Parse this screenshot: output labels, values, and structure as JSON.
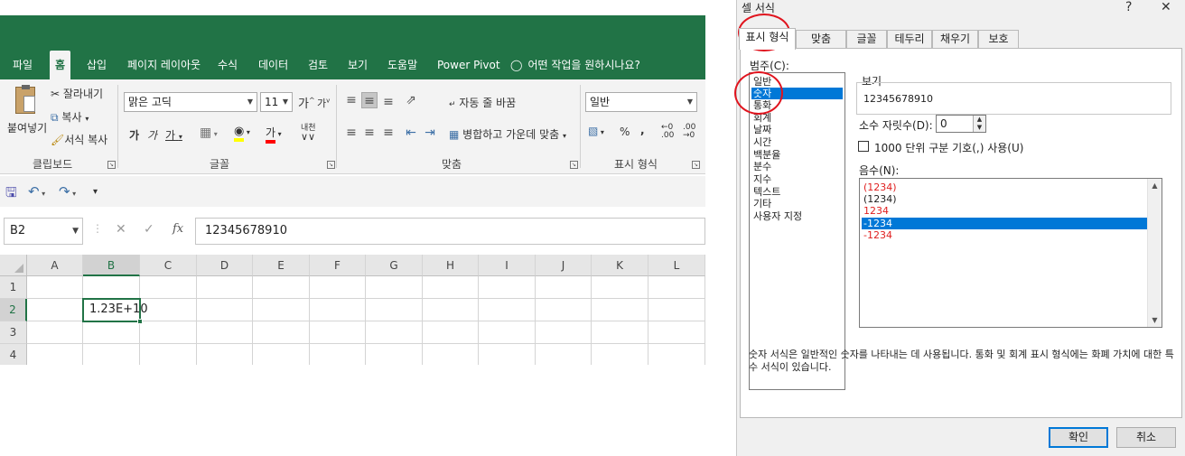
{
  "excel": {
    "tabs": [
      "파일",
      "홈",
      "삽입",
      "페이지 레이아웃",
      "수식",
      "데이터",
      "검토",
      "보기",
      "도움말",
      "Power Pivot",
      "어떤 작업을 원하시나요?"
    ],
    "clipboard": {
      "paste": "붙여넣기",
      "cut": "잘라내기",
      "copy": "복사",
      "format_painter": "서식 복사",
      "group_label": "클립보드"
    },
    "font": {
      "name": "맑은 고딕",
      "size": "11",
      "grow": "가",
      "shrink": "가",
      "bold": "가",
      "italic": "가",
      "underline": "가",
      "font_color": "가",
      "phonetic": "내천",
      "group_label": "글꼴"
    },
    "alignment": {
      "wrap_text": "자동 줄 바꿈",
      "merge_center": "병합하고 가운데 맞춤",
      "group_label": "맞춤"
    },
    "number": {
      "format": "일반",
      "percent": "%",
      "comma": ",",
      "group_label": "표시 형식"
    },
    "formula_bar": {
      "name_box": "B2",
      "fx": "fx",
      "value": "12345678910"
    },
    "grid": {
      "columns": [
        "A",
        "B",
        "C",
        "D",
        "E",
        "F",
        "G",
        "H",
        "I",
        "J",
        "K",
        "L"
      ],
      "rows": [
        "1",
        "2",
        "3",
        "4"
      ],
      "active_cell_value": "1.23E+10"
    }
  },
  "dialog": {
    "title": "셀 서식",
    "help": "?",
    "close": "✕",
    "tabs": [
      "표시 형식",
      "맞춤",
      "글꼴",
      "테두리",
      "채우기",
      "보호"
    ],
    "category_label": "범주(C):",
    "categories": [
      "일반",
      "숫자",
      "통화",
      "회계",
      "날짜",
      "시간",
      "백분율",
      "분수",
      "지수",
      "텍스트",
      "기타",
      "사용자 지정"
    ],
    "selected_category": "숫자",
    "sample_label": "보기",
    "sample_value": "12345678910",
    "decimal_label": "소수 자릿수(D):",
    "decimal_value": "0",
    "thousands_label": "1000 단위 구분 기호(,) 사용(U)",
    "negative_label": "음수(N):",
    "negative_options": [
      {
        "text": "(1234)",
        "style": "red"
      },
      {
        "text": "(1234)",
        "style": "normal"
      },
      {
        "text": "1234",
        "style": "red"
      },
      {
        "text": "-1234",
        "style": "selected"
      },
      {
        "text": "-1234",
        "style": "red"
      }
    ],
    "description": "숫자 서식은 일반적인 숫자를 나타내는 데 사용됩니다. 통화 및 회계 표시 형식에는 화폐 가치에 대한 특수 서식이 있습니다.",
    "ok": "확인",
    "cancel": "취소"
  },
  "colors": {
    "excel_green": "#217346",
    "selection_blue": "#0078d7",
    "negative_red": "#e02020",
    "annotation_red": "#e0141e"
  }
}
